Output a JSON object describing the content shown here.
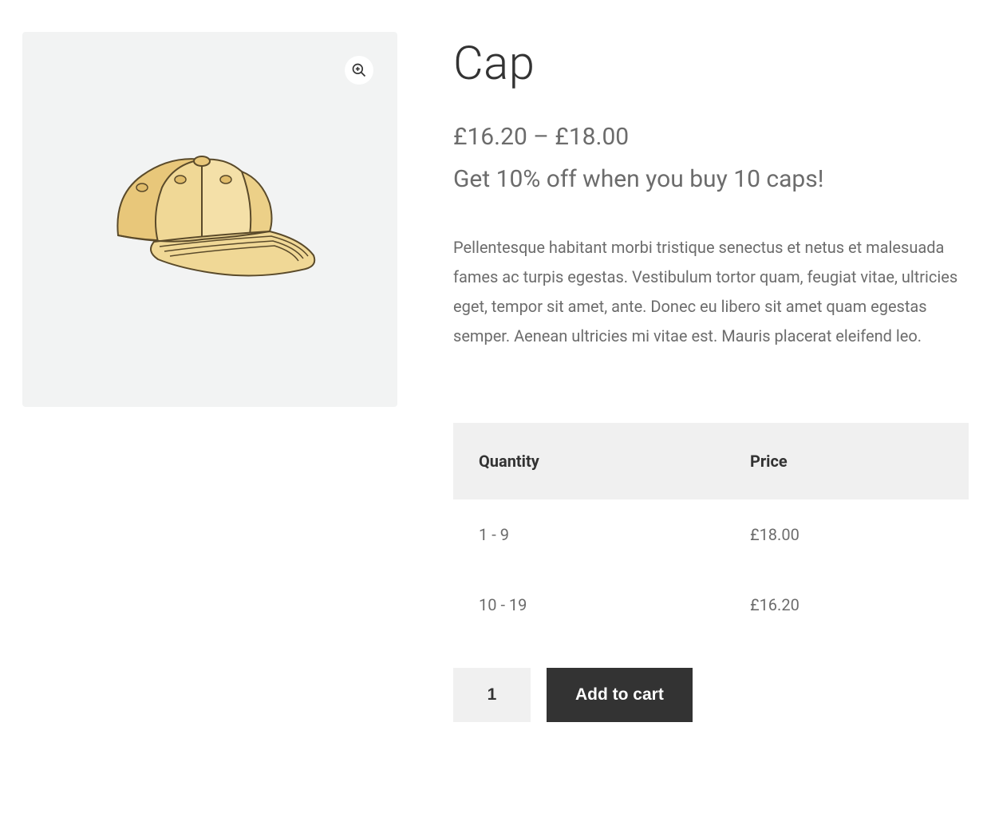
{
  "product": {
    "title": "Cap",
    "price_range": "£16.20 – £18.00",
    "promo": "Get 10% off when you buy 10 caps!",
    "description": "Pellentesque habitant morbi tristique senectus et netus et malesuada fames ac turpis egestas. Vestibulum tortor quam, feugiat vitae, ultricies eget, tempor sit amet, ante. Donec eu libero sit amet quam egestas semper. Aenean ultricies mi vitae est. Mauris placerat eleifend leo."
  },
  "price_table": {
    "headers": {
      "quantity": "Quantity",
      "price": "Price"
    },
    "rows": [
      {
        "quantity": "1 - 9",
        "price": "£18.00"
      },
      {
        "quantity": "10 - 19",
        "price": "£16.20"
      }
    ]
  },
  "cart": {
    "quantity_value": "1",
    "add_label": "Add to cart"
  }
}
